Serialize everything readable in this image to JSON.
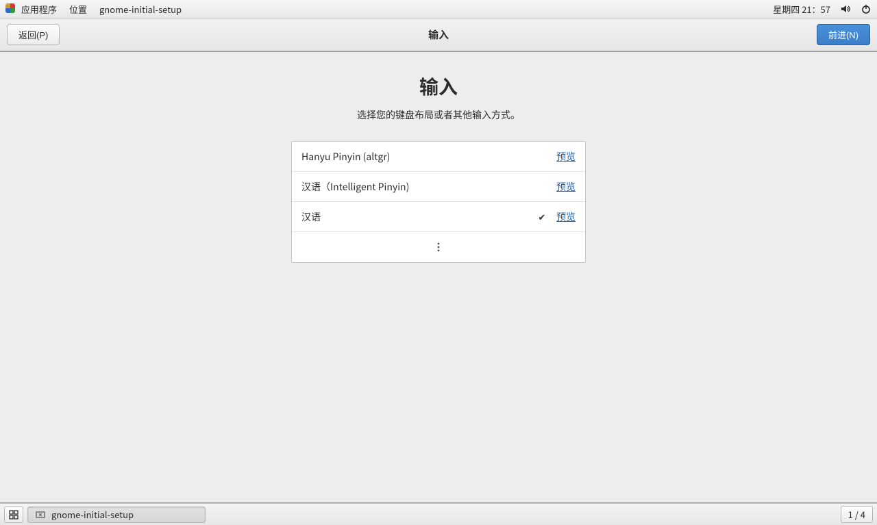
{
  "system_bar": {
    "applications": "应用程序",
    "places": "位置",
    "app_name": "gnome-initial-setup",
    "datetime": "星期四 21：57"
  },
  "header": {
    "back": "返回(P)",
    "title": "输入",
    "next": "前进(N)"
  },
  "page": {
    "title": "输入",
    "subtitle": "选择您的键盘布局或者其他输入方式。"
  },
  "input_sources": [
    {
      "label": "Hanyu Pinyin (altgr)",
      "selected": false,
      "preview": "预览"
    },
    {
      "label": "汉语（Intelligent Pinyin)",
      "selected": false,
      "preview": "预览"
    },
    {
      "label": "汉语",
      "selected": true,
      "preview": "预览"
    }
  ],
  "task_bar": {
    "app_label": "gnome-initial-setup",
    "workspace": "1 / 4"
  }
}
